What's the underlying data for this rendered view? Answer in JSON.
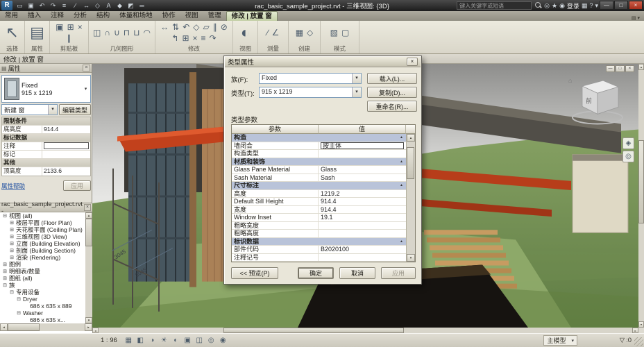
{
  "icons": {
    "close": "×",
    "down": "▾",
    "up": "▴",
    "left": "◂",
    "right": "▸",
    "panel": "▤",
    "home": "⌂"
  },
  "titlebar": {
    "app_title": "rac_basic_sample_project.rvt - 三维视图: {3D}",
    "search_placeholder": "键入关键字或短语",
    "login_label": "登录",
    "qat": [
      {
        "name": "open-icon",
        "g": "▭"
      },
      {
        "name": "save-icon",
        "g": "▣"
      },
      {
        "name": "undo-icon",
        "g": "↶"
      },
      {
        "name": "redo-icon",
        "g": "↷"
      },
      {
        "name": "print-icon",
        "g": "≡"
      },
      {
        "name": "measure-icon",
        "g": "∕"
      },
      {
        "name": "dimension-icon",
        "g": "↔"
      },
      {
        "name": "tag-icon",
        "g": "◇"
      },
      {
        "name": "text-icon",
        "g": "A"
      },
      {
        "name": "3d-view-icon",
        "g": "◆"
      },
      {
        "name": "section-icon",
        "g": "◩"
      },
      {
        "name": "thin-lines-icon",
        "g": "═"
      }
    ],
    "right_icons_a": [
      {
        "name": "communication-center-icon",
        "g": "◎"
      },
      {
        "name": "favorites-icon",
        "g": "★"
      },
      {
        "name": "account-icon",
        "g": "◉"
      }
    ],
    "right_icons_b": [
      {
        "name": "exchange-apps-icon",
        "g": "▦"
      },
      {
        "name": "help-icon",
        "g": "?"
      },
      {
        "name": "help-dropdown-icon",
        "g": "▾"
      }
    ],
    "window_controls": [
      {
        "name": "minimize-icon",
        "g": "—"
      },
      {
        "name": "maximize-icon",
        "g": "□"
      },
      {
        "name": "close-icon",
        "g": "×"
      }
    ]
  },
  "ribbon": {
    "tabs": [
      {
        "label": "常用"
      },
      {
        "label": "插入"
      },
      {
        "label": "注释"
      },
      {
        "label": "分析"
      },
      {
        "label": "结构"
      },
      {
        "label": "体量和场地"
      },
      {
        "label": "协作"
      },
      {
        "label": "视图"
      },
      {
        "label": "管理"
      },
      {
        "label": "修改 | 放置 窗",
        "active": true
      }
    ],
    "panels": [
      {
        "label": "选择",
        "icons": [
          {
            "name": "modify-select-icon",
            "g": "↖"
          }
        ]
      },
      {
        "label": "属性",
        "icons": [
          {
            "name": "properties-icon",
            "g": "▤"
          }
        ]
      },
      {
        "label": "剪贴板",
        "icons": [
          {
            "name": "paste-icon",
            "g": "▣"
          },
          {
            "name": "copy-icon",
            "g": "⊞"
          },
          {
            "name": "cut-icon",
            "g": "×"
          },
          {
            "name": "match-type-icon",
            "g": "∥"
          }
        ]
      },
      {
        "label": "几何图形",
        "icons": [
          {
            "name": "join-icon",
            "g": "◫"
          },
          {
            "name": "cut-geometry-icon",
            "g": "∩"
          },
          {
            "name": "paint-icon",
            "g": "∪"
          },
          {
            "name": "cope-icon",
            "g": "⊓"
          },
          {
            "name": "split-face-icon",
            "g": "⊔"
          },
          {
            "name": "demolish-icon",
            "g": "◠"
          }
        ]
      },
      {
        "label": "修改",
        "icons": [
          {
            "name": "move-icon",
            "g": "↔"
          },
          {
            "name": "offset-icon",
            "g": "⇅"
          },
          {
            "name": "rotate-icon",
            "g": "↶"
          },
          {
            "name": "mirror-icon",
            "g": "◇"
          },
          {
            "name": "array-icon",
            "g": "▱"
          },
          {
            "name": "align-icon",
            "g": "∥"
          },
          {
            "name": "split-icon",
            "g": "⊘"
          },
          {
            "name": "trim-icon",
            "g": "↰"
          },
          {
            "name": "pin-icon",
            "g": "⊞"
          },
          {
            "name": "delete-icon",
            "g": "×"
          },
          {
            "name": "scale-icon",
            "g": "≡"
          },
          {
            "name": "extend-icon",
            "g": "↷"
          }
        ]
      },
      {
        "label": "视图",
        "icons": [
          {
            "name": "view-panel-icon",
            "g": "◐"
          }
        ]
      },
      {
        "label": "测量",
        "icons": [
          {
            "name": "measure-panel-icon",
            "g": "∕"
          },
          {
            "name": "angle-dimension-icon",
            "g": "∠"
          }
        ]
      },
      {
        "label": "创建",
        "icons": [
          {
            "name": "create-group-icon",
            "g": "▦"
          },
          {
            "name": "create-similar-icon",
            "g": "◇"
          }
        ]
      },
      {
        "label": "模式",
        "icons": [
          {
            "name": "window-mode-icon",
            "g": "▧"
          },
          {
            "name": "load-family-icon",
            "g": "▢"
          }
        ]
      }
    ]
  },
  "options_bar": {
    "mode_label": "修改 | 放置 窗"
  },
  "palette": {
    "title": "属性",
    "family_name": "Fixed",
    "type_name": "915 x 1219",
    "selector_caption": "新建 窗",
    "edit_type_label": "编辑类型",
    "rows": [
      {
        "type": "header",
        "label": "限制条件"
      },
      {
        "type": "row",
        "label": "底高度",
        "value": "914.4"
      },
      {
        "type": "header",
        "label": "标记数据"
      },
      {
        "type": "row",
        "label": "注释",
        "value": "",
        "editing": true
      },
      {
        "type": "row",
        "label": "标记",
        "value": ""
      },
      {
        "type": "header",
        "label": "其他"
      },
      {
        "type": "row",
        "label": "顶高度",
        "value": "2133.6"
      }
    ],
    "help_label": "属性帮助",
    "apply_label": "应用"
  },
  "browser": {
    "title": "rac_basic_sample_project.rvt - ...",
    "items": [
      {
        "glyph": "⊟",
        "label": "视图 (all)",
        "indent": 0
      },
      {
        "glyph": "⊞",
        "label": "楼层平面 (Floor Plan)",
        "indent": 1
      },
      {
        "glyph": "⊞",
        "label": "天花板平面 (Ceiling Plan)",
        "indent": 1
      },
      {
        "glyph": "⊞",
        "label": "三维视图 (3D View)",
        "indent": 1
      },
      {
        "glyph": "⊞",
        "label": "立面 (Building Elevation)",
        "indent": 1
      },
      {
        "glyph": "⊞",
        "label": "剖面 (Building Section)",
        "indent": 1
      },
      {
        "glyph": "⊞",
        "label": "渲染 (Rendering)",
        "indent": 1
      },
      {
        "glyph": "⊞",
        "label": "图例",
        "indent": 0
      },
      {
        "glyph": "⊞",
        "label": "明细表/数量",
        "indent": 0
      },
      {
        "glyph": "⊞",
        "label": "图纸 (all)",
        "indent": 0
      },
      {
        "glyph": "⊟",
        "label": "族",
        "indent": 0
      },
      {
        "glyph": "⊟",
        "label": "专用设备",
        "indent": 1
      },
      {
        "glyph": "⊟",
        "label": "Dryer",
        "indent": 2
      },
      {
        "glyph": "",
        "label": "686 x 635 x 889",
        "indent": 3
      },
      {
        "glyph": "⊟",
        "label": "Washer",
        "indent": 2
      },
      {
        "glyph": "",
        "label": "686 x 635 x...",
        "indent": 3
      }
    ]
  },
  "dialog": {
    "title": "类型属性",
    "family_label": "族(F):",
    "family_value": "Fixed",
    "type_label": "类型(T):",
    "type_value": "915 x 1219",
    "load_label": "载入(L)...",
    "duplicate_label": "复制(D)...",
    "rename_label": "重命名(R)...",
    "params_caption": "类型参数",
    "col_param": "参数",
    "col_value": "值",
    "rows": [
      {
        "type": "group",
        "label": "构造"
      },
      {
        "type": "row",
        "label": "墙闭合",
        "value": "按主体",
        "editing": true
      },
      {
        "type": "row",
        "label": "构造类型",
        "value": ""
      },
      {
        "type": "group",
        "label": "材质和装饰"
      },
      {
        "type": "row",
        "label": "Glass Pane Material",
        "value": "Glass"
      },
      {
        "type": "row",
        "label": "Sash Material",
        "value": "Sash"
      },
      {
        "type": "group",
        "label": "尺寸标注"
      },
      {
        "type": "row",
        "label": "高度",
        "value": "1219.2"
      },
      {
        "type": "row",
        "label": "Default Sill Height",
        "value": "914.4"
      },
      {
        "type": "row",
        "label": "宽度",
        "value": "914.4"
      },
      {
        "type": "row",
        "label": "Window Inset",
        "value": "19.1"
      },
      {
        "type": "row",
        "label": "粗略宽度",
        "value": ""
      },
      {
        "type": "row",
        "label": "粗略高度",
        "value": ""
      },
      {
        "type": "group",
        "label": "标识数据"
      },
      {
        "type": "row",
        "label": "部件代码",
        "value": "B2020100"
      },
      {
        "type": "row",
        "label": "注释记号",
        "value": ""
      }
    ],
    "preview_label": "<< 预览(P)",
    "ok_label": "确定",
    "cancel_label": "取消",
    "apply_label": "应用"
  },
  "canvas": {
    "annotations": [
      "3045",
      "3045"
    ],
    "viewcube_front": "前",
    "window_controls": [
      {
        "name": "view-minimize-icon",
        "g": "—"
      },
      {
        "name": "view-restore-icon",
        "g": "□"
      },
      {
        "name": "view-close-icon",
        "g": "×"
      }
    ],
    "nav_icons": [
      {
        "name": "steering-wheel-icon",
        "g": "◈"
      },
      {
        "name": "zoom-tool-icon",
        "g": "◎"
      }
    ]
  },
  "statusbar": {
    "scale": "1 : 96",
    "vcb_icons": [
      {
        "name": "scale-icon",
        "g": "▦"
      },
      {
        "name": "detail-level-icon",
        "g": "◧"
      },
      {
        "name": "visual-style-icon",
        "g": "◑"
      },
      {
        "name": "sun-path-icon",
        "g": "☀"
      },
      {
        "name": "shadows-icon",
        "g": "◐"
      },
      {
        "name": "crop-view-icon",
        "g": "▣"
      },
      {
        "name": "crop-region-icon",
        "g": "◫"
      },
      {
        "name": "temporary-hide-icon",
        "g": "◎"
      },
      {
        "name": "reveal-hidden-icon",
        "g": "◉"
      }
    ],
    "model_label": "主模型",
    "filter_glyph": "▽",
    "selection_count": ":0"
  }
}
